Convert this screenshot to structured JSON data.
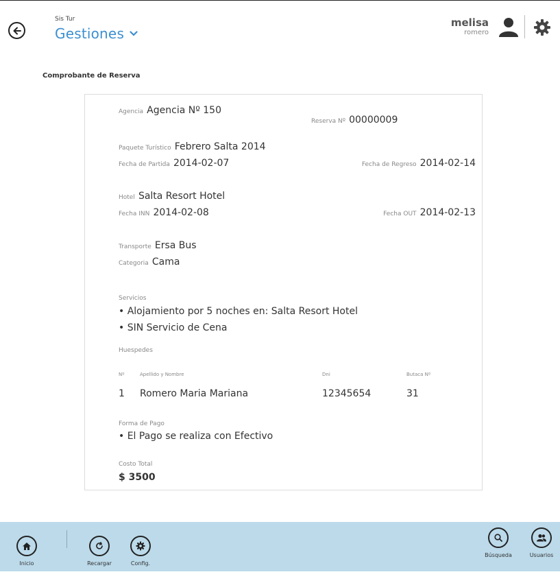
{
  "header": {
    "app_name": "Sis Tur",
    "title": "Gestiones",
    "user_first": "melisa",
    "user_last": "romero"
  },
  "section_title": "Comprobante de Reserva",
  "voucher": {
    "agencia_label": "Agencia",
    "agencia_value": "Agencia Nº 150",
    "reserva_label": "Reserva Nº",
    "reserva_value": "00000009",
    "paquete_label": "Paquete Turístico",
    "paquete_value": "Febrero Salta 2014",
    "partida_label": "Fecha de Partida",
    "partida_value": "2014-02-07",
    "regreso_label": "Fecha de Regreso",
    "regreso_value": "2014-02-14",
    "hotel_label": "Hotel",
    "hotel_value": "Salta Resort Hotel",
    "inn_label": "Fecha INN",
    "inn_value": "2014-02-08",
    "out_label": "Fecha OUT",
    "out_value": "2014-02-13",
    "transporte_label": "Transporte",
    "transporte_value": "Ersa Bus",
    "categoria_label": "Categoria",
    "categoria_value": "Cama",
    "servicios_label": "Servicios",
    "servicios": [
      "• Alojamiento por 5 noches en: Salta Resort Hotel",
      "• SIN Servicio de Cena"
    ],
    "huespedes_label": "Huespedes",
    "guest_cols": {
      "num": "Nº",
      "nombre": "Apellido y Nombre",
      "dni": "Dni",
      "butaca": "Butaca Nº"
    },
    "guests": [
      {
        "num": "1",
        "nombre": "Romero Maria Mariana",
        "dni": "12345654",
        "butaca": "31"
      }
    ],
    "pago_label": "Forma de Pago",
    "pago_value": "• El Pago se realiza con Efectivo",
    "costo_label": "Costo Total",
    "costo_value": "$ 3500"
  },
  "bottom_nav": {
    "inicio": "Inicio",
    "recargar": "Recargar",
    "config": "Config.",
    "busqueda": "Búsqueda",
    "usuarios": "Usuarios"
  },
  "colors": {
    "accent": "#3c8fd0",
    "bottom_bar": "#bcdaea"
  }
}
